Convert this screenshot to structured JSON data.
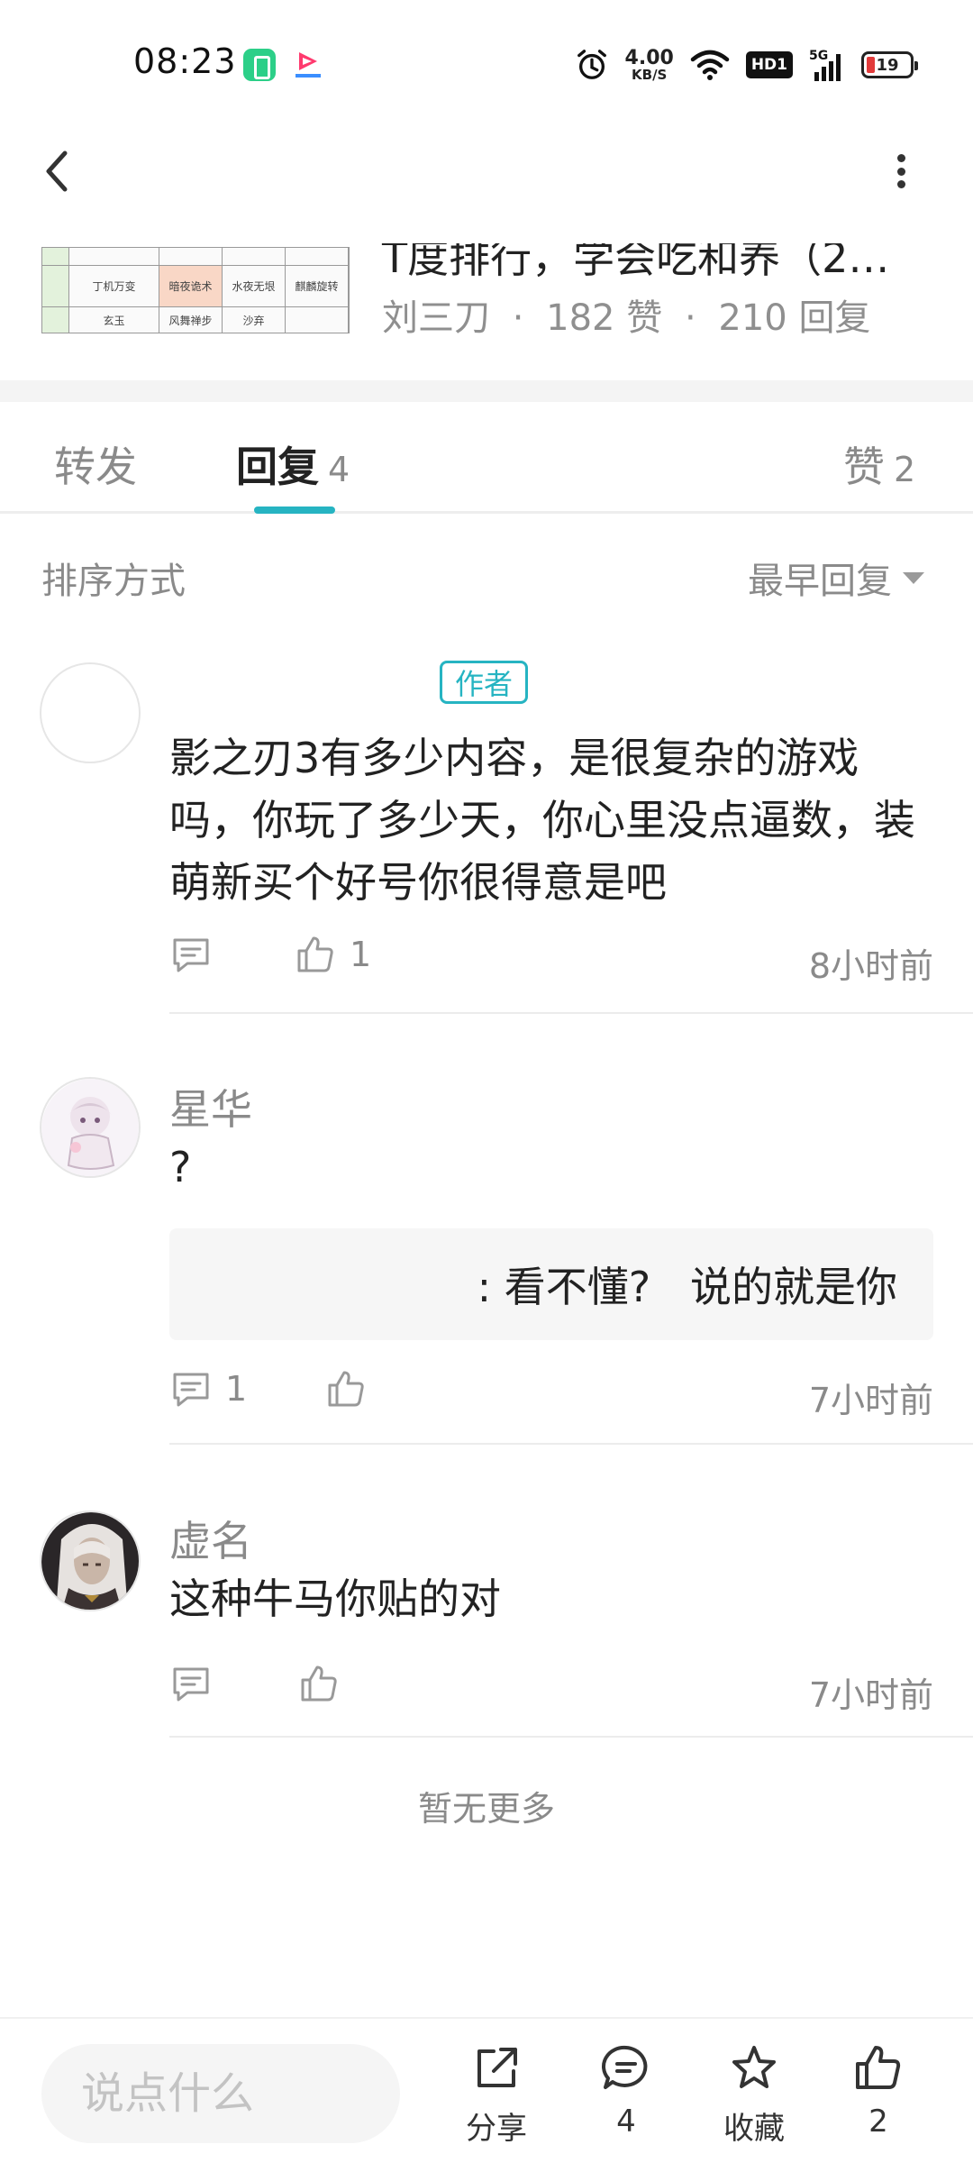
{
  "status_bar": {
    "time": "08:23",
    "net_speed_value": "4.00",
    "net_speed_unit": "KB/S",
    "hd_badge": "HD1",
    "signal_type": "5G",
    "battery_level": "19",
    "icons": [
      "battery-app-icon",
      "video-app-icon",
      "alarm-icon",
      "wifi-icon",
      "signal-icon",
      "battery-icon"
    ]
  },
  "nav": {
    "back_icon": "chevron-left-icon",
    "more_icon": "more-vertical-icon"
  },
  "post": {
    "title_fragment": "T度排行，学会吃和养（2…",
    "author": "刘三刀",
    "likes": "182 赞",
    "replies": "210 回复",
    "separator": "·",
    "thumb_cells": [
      "丁机万变",
      "暗夜诡术",
      "水夜无垠",
      "麒麟旋转",
      "玄玉",
      "风舞禅步",
      "沙弃"
    ]
  },
  "tabs": {
    "forward_label": "转发",
    "reply_label": "回复",
    "reply_count": "4",
    "like_label": "赞",
    "like_count": "2"
  },
  "sort": {
    "label": "排序方式",
    "selected": "最早回复"
  },
  "comments": [
    {
      "badge": "作者",
      "text": "影之刃3有多少内容，是很复杂的游戏吗，你玩了多少天，你心里没点逼数，装萌新买个好号你很得意是吧",
      "reply_count": "",
      "like_count": "1",
      "time": "8小时前"
    },
    {
      "name": "星华",
      "text": "?",
      "quote": ": 看不懂?   说的就是你",
      "reply_count": "1",
      "like_count": "",
      "time": "7小时前"
    },
    {
      "name": "虚名",
      "text": "这种牛马你贴的对",
      "reply_count": "",
      "like_count": "",
      "time": "7小时前"
    }
  ],
  "footer_note": "暂无更多",
  "bottom_bar": {
    "input_placeholder": "说点什么",
    "share_label": "分享",
    "comment_count": "4",
    "favorite_label": "收藏",
    "like_count": "2"
  },
  "colors": {
    "accent": "#26b4c2",
    "muted_text": "#8a8a8a",
    "primary_text": "#222222",
    "battery_low": "#e23b3b"
  }
}
